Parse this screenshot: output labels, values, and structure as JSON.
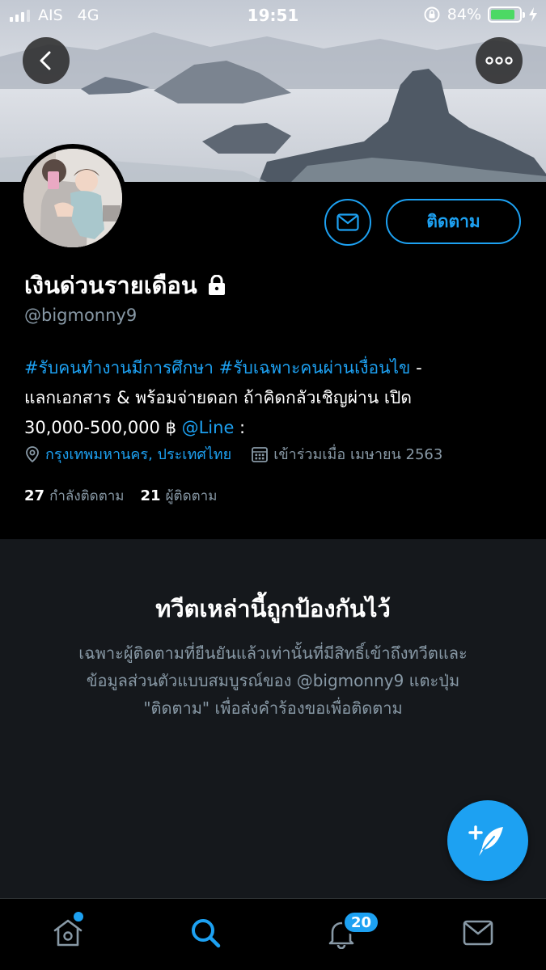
{
  "status_bar": {
    "carrier": "AIS",
    "network": "4G",
    "time": "19:51",
    "battery": "84%",
    "battery_level": 0.84
  },
  "profile": {
    "display_name": "เงินด่วนรายเดือน",
    "handle": "@bigmonny9",
    "follow_label": "ติดตาม",
    "bio": {
      "hashtag_1": "#รับคนทำงานมีการศึกษา",
      "hashtag_2": "#รับเฉพาะคนผ่านเงื่อนไข",
      "text_1": " -",
      "text_2": "แลกเอกสาร & พร้อมจ่ายดอก ถ้าคิดกลัวเชิญผ่าน เปิด",
      "text_3": "30,000-500,000 ฿ ",
      "link": "@Line",
      "text_4": " :"
    },
    "location": "กรุงเทพมหานคร, ประเทศไทย",
    "joined": "เข้าร่วมเมื่อ เมษายน 2563",
    "following_count": "27",
    "following_label": "กำลังติดตาม",
    "followers_count": "21",
    "followers_label": "ผู้ติดตาม"
  },
  "protected": {
    "title": "ทวีตเหล่านี้ถูกป้องกันไว้",
    "line_1": "เฉพาะผู้ติดตามที่ยืนยันแล้วเท่านั้นที่มีสิทธิ์เข้าถึงทวีตและ",
    "line_2": "ข้อมูลส่วนตัวแบบสมบูรณ์ของ @bigmonny9 แตะปุ่ม",
    "line_3": "\"ติดตาม\" เพื่อส่งคำร้องขอเพื่อติดตาม"
  },
  "tabbar": {
    "notifications_badge": "20"
  },
  "colors": {
    "accent": "#1da1f2",
    "background": "#000000",
    "secondary_text": "#8899a6",
    "panel": "#15181c"
  }
}
